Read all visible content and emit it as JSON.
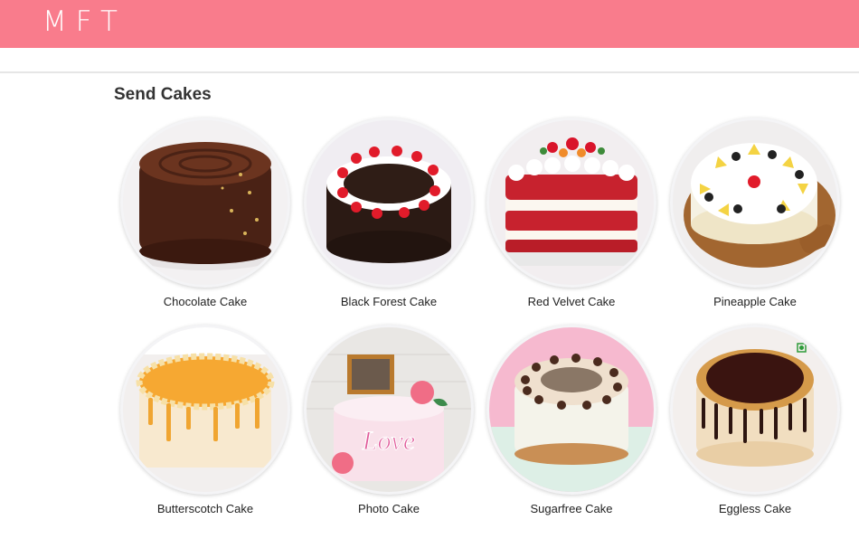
{
  "header": {
    "logo": "MFT",
    "brand_color": "#f97c8c"
  },
  "section": {
    "title": "Send Cakes",
    "cakes": [
      {
        "name": "Chocolate Cake"
      },
      {
        "name": "Black Forest Cake"
      },
      {
        "name": "Red Velvet Cake"
      },
      {
        "name": "Pineapple Cake"
      },
      {
        "name": "Butterscotch Cake"
      },
      {
        "name": "Photo Cake",
        "cake_text": "Love"
      },
      {
        "name": "Sugarfree Cake"
      },
      {
        "name": "Eggless Cake"
      }
    ]
  }
}
